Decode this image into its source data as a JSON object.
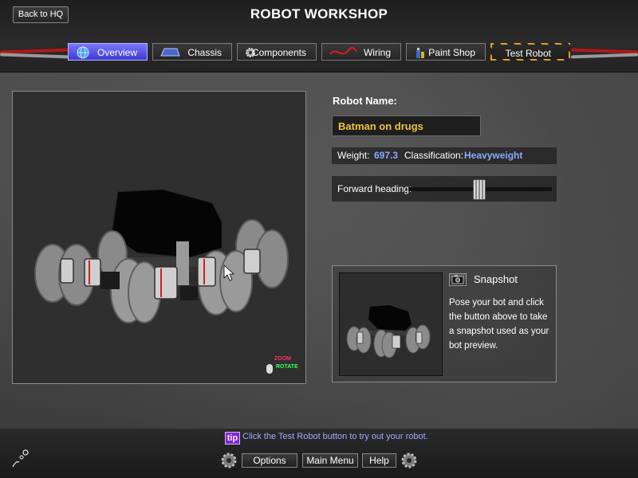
{
  "header": {
    "back_label": "Back to HQ",
    "title": "ROBOT WORKSHOP"
  },
  "tabs": [
    {
      "label": "Overview",
      "icon": "globe-icon",
      "active": true
    },
    {
      "label": "Chassis",
      "icon": "chassis-icon"
    },
    {
      "label": "Components",
      "icon": "gear-icon"
    },
    {
      "label": "Wiring",
      "icon": "wire-icon"
    },
    {
      "label": "Paint Shop",
      "icon": "spray-can-icon"
    },
    {
      "label": "Test Robot",
      "icon": "hazard-stripes"
    }
  ],
  "viewport": {
    "zoom_label": "ZOOM",
    "rotate_label": "ROTATE"
  },
  "robot": {
    "name_label": "Robot Name:",
    "name_value": "Batman on drugs",
    "weight_label": "Weight:",
    "weight_value": "697.3",
    "class_label": "Classification:",
    "class_value": "Heavyweight",
    "heading_label": "Forward heading:",
    "heading_fraction": 0.49
  },
  "snapshot": {
    "title": "Snapshot",
    "description": "Pose your bot and click the button above to take a snapshot used as your bot preview."
  },
  "footer": {
    "tip_badge": "tip",
    "tip_text": "Click the Test Robot button to try out your robot.",
    "options_label": "Options",
    "main_menu_label": "Main Menu",
    "help_label": "Help"
  },
  "colors": {
    "accent_blue": "#8aa8ff",
    "active_tab": "#5552e8",
    "name_text": "#f0c040",
    "tip_text": "#a6a8ff"
  }
}
